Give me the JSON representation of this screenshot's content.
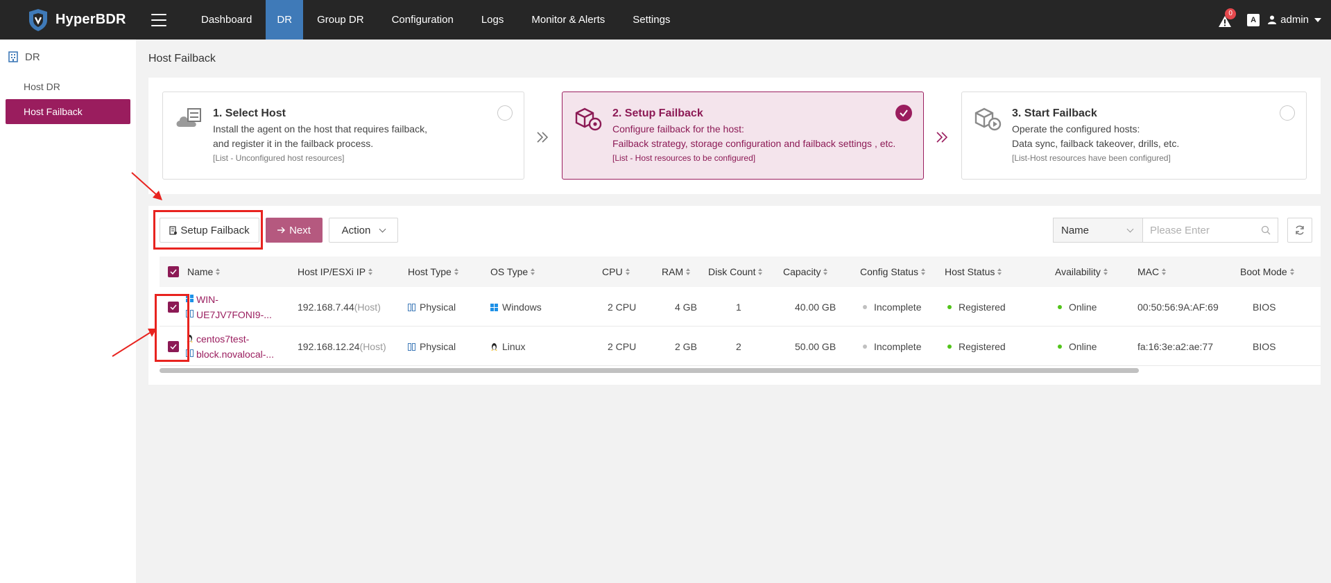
{
  "app": {
    "name": "HyperBDR"
  },
  "nav": {
    "items": [
      "Dashboard",
      "DR",
      "Group DR",
      "Configuration",
      "Logs",
      "Monitor & Alerts",
      "Settings"
    ],
    "active": "DR"
  },
  "header": {
    "alert_count": "0",
    "lang_icon": "A",
    "user": "admin"
  },
  "sidebar": {
    "section": "DR",
    "items": [
      {
        "label": "Host DR",
        "active": false
      },
      {
        "label": "Host Failback",
        "active": true
      }
    ]
  },
  "page": {
    "title": "Host Failback"
  },
  "steps": [
    {
      "title": "1. Select Host",
      "desc1": "Install the agent on the host that requires failback,",
      "desc2": "and register it in the failback process.",
      "note": "[List - Unconfigured host resources]",
      "state": "pending"
    },
    {
      "title": "2. Setup Failback",
      "desc1": "Configure failback for the host:",
      "desc2": "Failback strategy, storage configuration and failback settings , etc.",
      "note": "[List - Host resources to be configured]",
      "state": "active"
    },
    {
      "title": "3. Start Failback",
      "desc1": "Operate the configured hosts:",
      "desc2": "Data sync, failback takeover, drills, etc.",
      "note": "[List-Host resources have been configured]",
      "state": "pending"
    }
  ],
  "toolbar": {
    "setup_label": "Setup Failback",
    "next_label": "Next",
    "action_label": "Action",
    "search_field": "Name",
    "search_placeholder": "Please Enter"
  },
  "table": {
    "columns": [
      "Name",
      "Host IP/ESXi IP",
      "Host Type",
      "OS Type",
      "CPU",
      "RAM",
      "Disk Count",
      "Capacity",
      "Config Status",
      "Host Status",
      "Availability",
      "MAC",
      "Boot Mode"
    ],
    "rows": [
      {
        "name_line1": "WIN-",
        "name_line2": "UE7JV7FONI9-...",
        "os_icon": "windows-icon",
        "ip": "192.168.7.44",
        "ip_suffix": "(Host)",
        "host_type": "Physical",
        "os_type": "Windows",
        "cpu": "2 CPU",
        "ram": "4 GB",
        "disk_count": "1",
        "capacity": "40.00 GB",
        "config_status": "Incomplete",
        "host_status": "Registered",
        "availability": "Online",
        "mac": "00:50:56:9A:AF:69",
        "boot_mode": "BIOS",
        "checked": true
      },
      {
        "name_line1": "centos7test-",
        "name_line2": "block.novalocal-...",
        "os_icon": "linux-icon",
        "ip": "192.168.12.24",
        "ip_suffix": "(Host)",
        "host_type": "Physical",
        "os_type": "Linux",
        "cpu": "2 CPU",
        "ram": "2 GB",
        "disk_count": "2",
        "capacity": "50.00 GB",
        "config_status": "Incomplete",
        "host_status": "Registered",
        "availability": "Online",
        "mac": "fa:16:3e:a2:ae:77",
        "boot_mode": "BIOS",
        "checked": true
      }
    ]
  },
  "colors": {
    "topbar": "#262626",
    "nav_active": "#3f7ab8",
    "brand": "#9a1d5e",
    "next_button": "#b5597f",
    "online": "#52c41a",
    "annotation": "#e8231f"
  }
}
